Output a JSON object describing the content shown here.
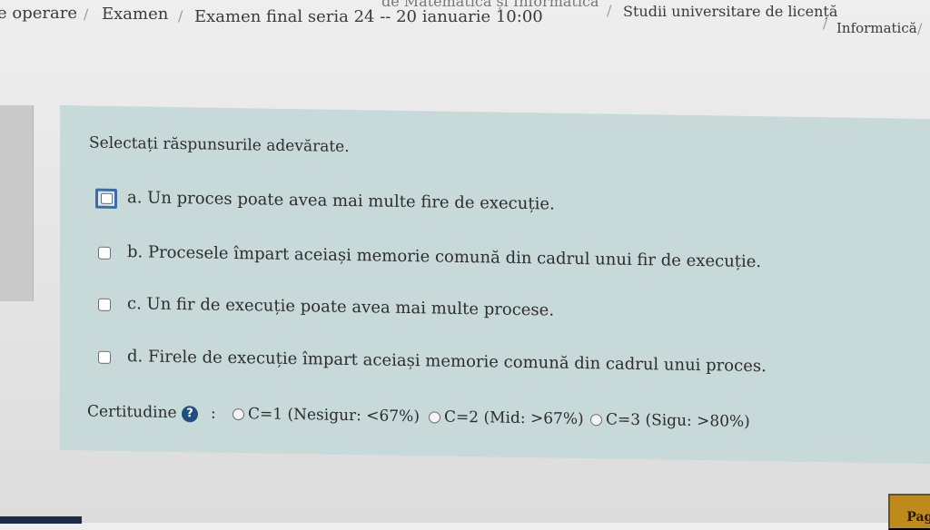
{
  "breadcrumb": {
    "item1": "e operare",
    "item2": "Examen",
    "item3": "Examen final seria 24 -- 20 ianuarie 10:00",
    "item4": "de Matematică și Informatică",
    "item5": "Studii universitare de licență",
    "item6": "Informatică",
    "separator": "/"
  },
  "question": {
    "prompt": "Selectați răspunsurile adevărate.",
    "answers": [
      {
        "label": "a. Un proces poate avea mai multe fire de execuție.",
        "checked": false,
        "focused": true
      },
      {
        "label": "b. Procesele împart aceiași memorie comună din cadrul unui fir de execuție.",
        "checked": false,
        "focused": false
      },
      {
        "label": "c. Un fir de execuție poate avea mai multe procese.",
        "checked": false,
        "focused": false
      },
      {
        "label": "d. Firele de execuție împart aceiași memorie comună din cadrul unui proces.",
        "checked": false,
        "focused": false
      }
    ]
  },
  "certainty": {
    "label": "Certitudine",
    "help_icon": "question-mark-circle-icon",
    "colon": ":",
    "options": [
      {
        "label": "C=1 (Nesigur: <67%)"
      },
      {
        "label": "C=2 (Mid: >67%)"
      },
      {
        "label": "C=3 (Sigu: >80%)"
      }
    ]
  },
  "footer": {
    "page_button_label": "Pagi"
  },
  "colors": {
    "card_background": "#c8d9da",
    "focus_ring": "#3c6dab",
    "help_icon": "#1f4f7d",
    "page_button": "#bf8a1c"
  }
}
